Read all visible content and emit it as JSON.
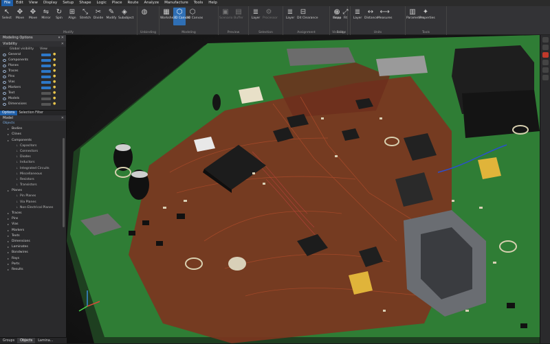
{
  "menu": [
    "File",
    "Edit",
    "View",
    "Display",
    "Setup",
    "Shape",
    "Logic",
    "Place",
    "Route",
    "Analyze",
    "Manufacture",
    "Tools",
    "Help"
  ],
  "menu_active_index": 0,
  "ribbon": {
    "groups": [
      {
        "title": "Modify",
        "buttons": [
          {
            "label": "Select",
            "icon": "cursor-icon"
          },
          {
            "label": "Move",
            "icon": "move-icon"
          },
          {
            "label": "Move",
            "icon": "move-icon"
          },
          {
            "label": "Mirror",
            "icon": "mirror-icon"
          },
          {
            "label": "Spin",
            "icon": "spin-icon"
          },
          {
            "label": "Align",
            "icon": "align-icon"
          },
          {
            "label": "Stretch",
            "icon": "stretch-icon"
          },
          {
            "label": "Divide",
            "icon": "divide-icon"
          },
          {
            "label": "Modify",
            "icon": "modify-icon"
          },
          {
            "label": "Subobject",
            "icon": "subobject-icon"
          }
        ]
      },
      {
        "title": "Unbinding",
        "buttons": [
          {
            "label": "",
            "icon": "globe-icon"
          }
        ]
      },
      {
        "title": "Modeling",
        "buttons": [
          {
            "label": "Worksheet",
            "icon": "worksheet-icon"
          },
          {
            "label": "3D Canvas",
            "icon": "cube-icon"
          },
          {
            "label": "2D Canvas",
            "icon": "cube-icon"
          }
        ]
      },
      {
        "title": "Preview",
        "buttons": [
          {
            "label": "Scenario",
            "icon": "scenario-icon"
          },
          {
            "label": "Buffer",
            "icon": "buffer-icon"
          }
        ]
      },
      {
        "title": "Selection",
        "buttons": [
          {
            "label": "Layer",
            "icon": "layer-icon"
          },
          {
            "label": "Processor",
            "icon": "processor-icon"
          }
        ]
      },
      {
        "title": "Assignment",
        "buttons": [
          {
            "label": "Layer",
            "icon": "layer-icon"
          },
          {
            "label": "Dit Clearance",
            "icon": "clearance-icon"
          }
        ]
      },
      {
        "title": "Visibility",
        "buttons": [
          {
            "label": "Inspo",
            "icon": "inspect-icon"
          }
        ]
      },
      {
        "title": "Snaps",
        "buttons": [
          {
            "label": "Snap",
            "icon": "snap-icon"
          },
          {
            "label": "Fit",
            "icon": "fit-icon"
          }
        ]
      },
      {
        "title": "Units",
        "buttons": [
          {
            "label": "Layer",
            "icon": "layer-icon"
          },
          {
            "label": "Distance",
            "icon": "distance-icon"
          },
          {
            "label": "Measures",
            "icon": "measure-icon"
          }
        ]
      },
      {
        "title": "Tools",
        "buttons": [
          {
            "label": "Parameters",
            "icon": "parameters-icon"
          },
          {
            "label": "Properties",
            "icon": "properties-icon"
          }
        ]
      }
    ]
  },
  "left_panel": {
    "title": "Modeling Options",
    "visibility": {
      "header": "Visibility",
      "col_a": "Global visibility",
      "col_b": "View",
      "rows": [
        "General",
        "Components",
        "Planes",
        "Traces",
        "Pins",
        "Vias",
        "Markers",
        "Text",
        "Models",
        "Dimensions"
      ]
    },
    "tabs": [
      "Options",
      "Selection Filter"
    ],
    "model": {
      "header": "Model",
      "root": "Objects",
      "items": [
        {
          "label": "Bodies",
          "level": 1
        },
        {
          "label": "Clines",
          "level": 1
        },
        {
          "label": "Components",
          "level": 1
        },
        {
          "label": "Capacitors",
          "level": 2
        },
        {
          "label": "Connectors",
          "level": 2
        },
        {
          "label": "Diodes",
          "level": 2
        },
        {
          "label": "Inductors",
          "level": 2
        },
        {
          "label": "Integrated Circuits",
          "level": 2
        },
        {
          "label": "Miscellaneous",
          "level": 2
        },
        {
          "label": "Resistors",
          "level": 2
        },
        {
          "label": "Transistors",
          "level": 2
        },
        {
          "label": "Planes",
          "level": 1
        },
        {
          "label": "Pin Planes",
          "level": 2
        },
        {
          "label": "Via Planes",
          "level": 2
        },
        {
          "label": "Non-Electrical Planes",
          "level": 2
        },
        {
          "label": "Traces",
          "level": 1
        },
        {
          "label": "Pins",
          "level": 1
        },
        {
          "label": "Vias",
          "level": 1
        },
        {
          "label": "Markers",
          "level": 1
        },
        {
          "label": "Texts",
          "level": 1
        },
        {
          "label": "Dimensions",
          "level": 1
        },
        {
          "label": "Laminates",
          "level": 1
        },
        {
          "label": "Bondwires",
          "level": 1
        },
        {
          "label": "Rays",
          "level": 1
        },
        {
          "label": "Ports",
          "level": 1
        },
        {
          "label": "Results",
          "level": 1
        }
      ]
    },
    "bottom_tabs": [
      "Groups",
      "Objects",
      "Lamina..."
    ]
  },
  "axes": {
    "x": "x",
    "y": "y",
    "z": "z"
  },
  "colors": {
    "accent": "#2f6fb5",
    "board_green": "#2f7d35",
    "copper": "#8a3a22",
    "ic_black": "#1c1c1c",
    "gold": "#e0b43a"
  }
}
